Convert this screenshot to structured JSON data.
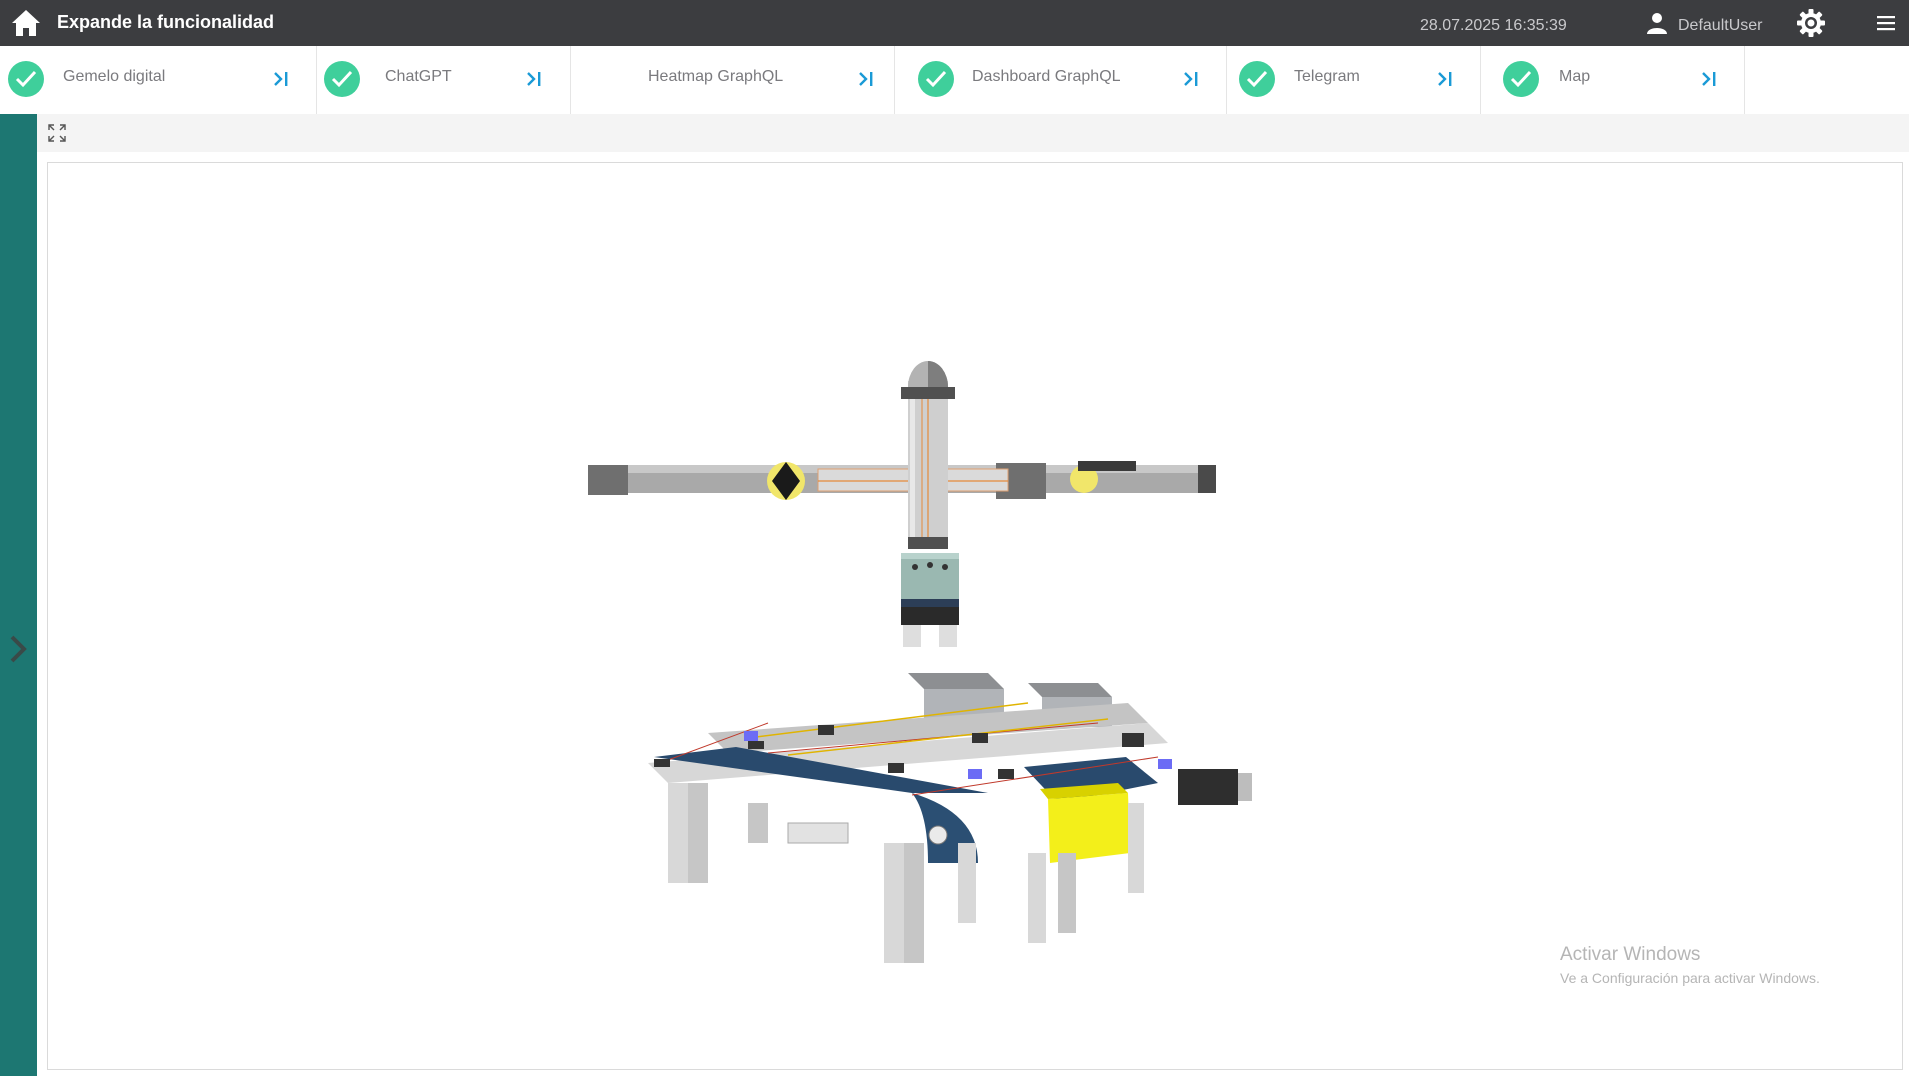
{
  "header": {
    "title": "Expande la funcionalidad",
    "datetime": "28.07.2025 16:35:39",
    "user": "DefaultUser",
    "icons": [
      "home-icon",
      "user-icon",
      "gear-icon",
      "menu-icon"
    ]
  },
  "tabs": [
    {
      "label": "Gemelo digital",
      "checked": true
    },
    {
      "label": "ChatGPT",
      "checked": true
    },
    {
      "label": "Heatmap GraphQL",
      "checked": false
    },
    {
      "label": "Dashboard GraphQL",
      "checked": true
    },
    {
      "label": "Telegram",
      "checked": true
    },
    {
      "label": "Map",
      "checked": true
    }
  ],
  "viewer": {
    "model": "3d-gantry-conveyor-model"
  },
  "watermark": {
    "title": "Activar Windows",
    "subtitle": "Ve a Configuración para activar Windows."
  },
  "colors": {
    "topbar": "#3c3d40",
    "sidebar": "#1d7772",
    "check": "#3fcf9b",
    "collapse_icon": "#1a9ad6"
  }
}
